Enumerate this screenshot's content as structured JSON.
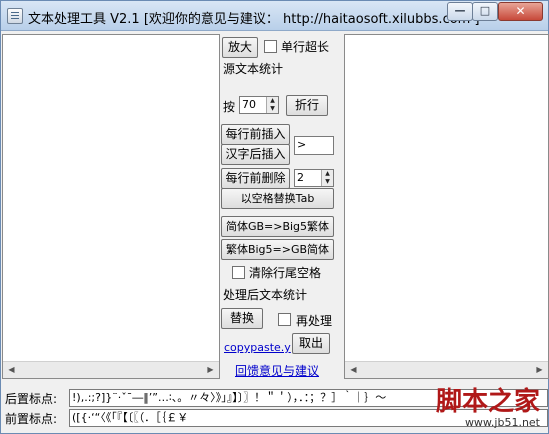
{
  "window": {
    "title": "文本处理工具 V2.1 [欢迎你的意见与建议： http://haitaosoft.xilubbs.com ]",
    "minimize_glyph": "—",
    "maximize_glyph": "□",
    "close_glyph": "✕"
  },
  "panel": {
    "zoom_button": "放大",
    "single_line_long_label": "单行超长",
    "source_stats_label": "源文本统计",
    "press_label": "按",
    "wrap_width_value": "70",
    "wrap_button": "折行",
    "prefix_insert_button": "每行前插入",
    "after_cjk_insert_button": "汉字后插入",
    "insert_value": ">",
    "delete_prefix_button": "每行前删除",
    "delete_count_value": "2",
    "space_to_tab_button": "以空格替换Tab",
    "gb_to_big5_button": "简体GB=>Big5繁体",
    "big5_to_gb_button": "繁体Big5=>GB简体",
    "trim_trailing_label": "清除行尾空格",
    "processed_stats_label": "处理后文本统计",
    "replace_button": "替换",
    "reprocess_label": "再处理",
    "copypaste_link": "copypaste.y",
    "fetch_button": "取出",
    "feedback_link": "回馈意见与建议"
  },
  "bottom": {
    "trailing_punct_label": "后置标点:",
    "trailing_punct_value": "!),.:;?]}¨·ˇˉ―‖’”…∶、。〃々〉》」』】〕〗！＂＇），．：；？］｀｜｝～",
    "leading_punct_label": "前置标点:",
    "leading_punct_value": "([{·‘“〈《「『【〔〖（．［｛￡￥"
  },
  "watermark": {
    "main": "脚本之家",
    "sub": "www.jb51.net"
  }
}
